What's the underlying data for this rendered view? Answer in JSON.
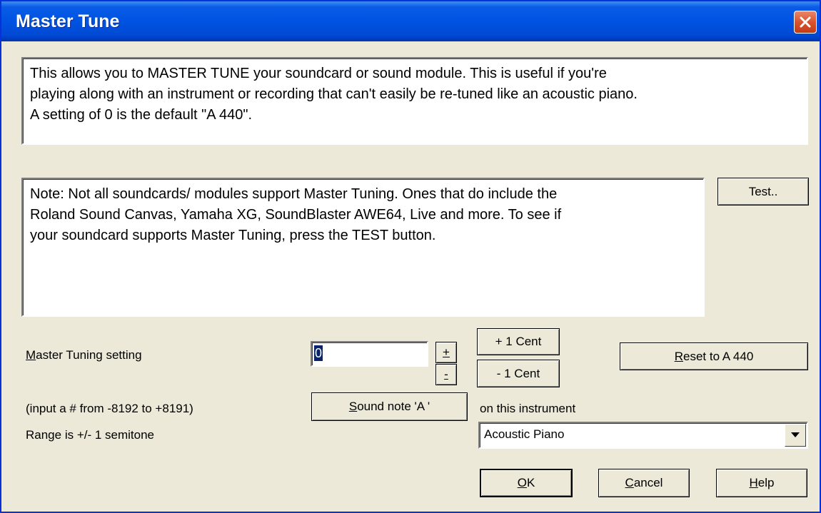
{
  "window": {
    "title": "Master Tune"
  },
  "description": {
    "line1": "This allows you to MASTER TUNE your soundcard or sound module. This is useful if you're",
    "line2": "playing along with an instrument or recording that can't easily be re-tuned like an acoustic piano.",
    "line3": "A setting of 0 is the default \"A  440\"."
  },
  "note": {
    "line1": "Note: Not all soundcards/ modules support Master Tuning. Ones that do include the",
    "line2": "Roland Sound Canvas, Yamaha XG, SoundBlaster AWE64, Live and more. To see if",
    "line3": "your soundcard supports Master Tuning, press the TEST button."
  },
  "buttons": {
    "test": "Test..",
    "plus": "+",
    "minus": "-",
    "plus_cent": "+ 1 Cent",
    "minus_cent": "- 1 Cent",
    "reset_hotkey": "R",
    "reset_rest": "eset to A 440",
    "sound_hotkey": "S",
    "sound_rest": "ound note 'A '",
    "ok_hotkey": "O",
    "ok_rest": "K",
    "cancel_hotkey": "C",
    "cancel_rest": "ancel",
    "help_hotkey": "H",
    "help_rest": "elp"
  },
  "tuning": {
    "label_hotkey": "M",
    "label_rest": "aster Tuning setting",
    "value": "0",
    "range_input": "(input a # from -8192 to +8191)",
    "range_info": "Range is +/- 1 semitone"
  },
  "instrument": {
    "label": "on this instrument",
    "selected": "Acoustic Piano"
  },
  "icons": {
    "close": "close-icon",
    "dropdown": "dropdown-arrow-icon"
  }
}
